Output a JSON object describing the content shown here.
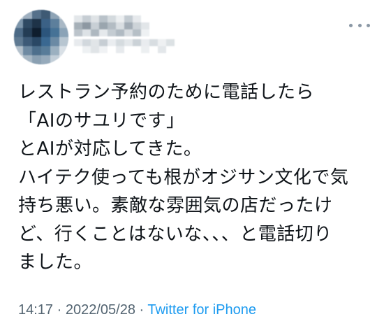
{
  "tweet": {
    "author": {
      "avatar_icon": "pixelated-avatar",
      "name_obscured": true
    },
    "more_icon": "more-horizontal-icon",
    "body_lines": [
      "レストラン予約のために電話したら",
      "「AIのサユリです」",
      "とAIが対応してきた。",
      "ハイテク使っても根がオジサン文化で気",
      "持ち悪い。素敵な雰囲気の店だったけ",
      "ど、行くことはないな、、、と電話切り",
      "ました。"
    ],
    "meta": {
      "time": "14:17",
      "separator1": " · ",
      "date": "2022/05/28",
      "separator2": " · ",
      "source": "Twitter for iPhone"
    },
    "colors": {
      "text": "#0f1419",
      "meta": "#536471",
      "link": "#1d9bf0"
    }
  }
}
